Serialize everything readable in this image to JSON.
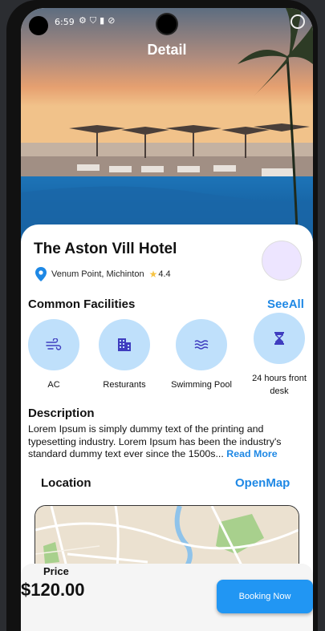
{
  "status_bar": {
    "time": "6:59",
    "icons": [
      "settings-icon",
      "shield-icon",
      "sim-icon",
      "block-icon"
    ]
  },
  "header": {
    "title": "Detail"
  },
  "hotel": {
    "name": "The Aston Vill Hotel",
    "location": "Venum Point, Michinton",
    "rating": "4.4"
  },
  "facilities": {
    "title": "Common Facilities",
    "see_all": "SeeAll",
    "items": [
      {
        "label": "AC",
        "icon": "wind-icon"
      },
      {
        "label": "Resturants",
        "icon": "building-icon"
      },
      {
        "label": "Swimming Pool",
        "icon": "waves-icon"
      },
      {
        "label": "24 hours front desk",
        "icon": "hourglass-icon"
      }
    ]
  },
  "description": {
    "title": "Description",
    "text": "Lorem Ipsum is simply dummy text of the printing and typesetting industry. Lorem Ipsum has been the industry's standard dummy text ever since the 1500s...",
    "read_more": "Read More"
  },
  "location": {
    "title": "Location",
    "open_map": "OpenMap"
  },
  "footer": {
    "price_label": "Price",
    "price": "$120.00",
    "book_label": "Booking Now"
  },
  "colors": {
    "accent": "#1e88e5",
    "facility_bg": "#bfe0fb",
    "facility_icon": "#3f3dbf"
  }
}
